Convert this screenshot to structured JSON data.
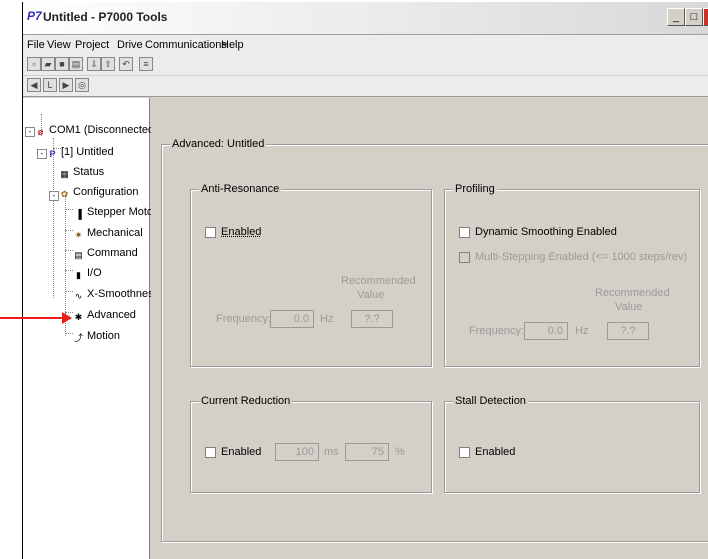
{
  "window": {
    "title": "Untitled - P7000 Tools",
    "app_icon": "P7"
  },
  "menu": [
    "File",
    "View",
    "Project",
    "Drive",
    "Communications",
    "Help"
  ],
  "tree": {
    "com1": "COM1 (Disconnected)",
    "project": "[1] Untitled",
    "status": "Status",
    "configuration": "Configuration",
    "stepper_motor": "Stepper Motor",
    "mechanical": "Mechanical",
    "command": "Command",
    "io": "I/O",
    "x_smoothness": "X-Smoothness",
    "advanced": "Advanced",
    "motion": "Motion"
  },
  "panel": {
    "title": "Advanced: Untitled",
    "anti_resonance": {
      "title": "Anti-Resonance",
      "enabled_label": "Enabled",
      "recommended_label": "Recommended",
      "value_label": "Value",
      "frequency_label": "Frequency:",
      "frequency_value": "0.0",
      "unit": "Hz",
      "recommended_value": "?.?"
    },
    "profiling": {
      "title": "Profiling",
      "dynamic_smoothing_label": "Dynamic Smoothing Enabled",
      "multi_stepping_label": "Multi-Stepping Enabled (<= 1000 steps/rev)",
      "recommended_label": "Recommended",
      "value_label": "Value",
      "frequency_label": "Frequency:",
      "frequency_value": "0.0",
      "unit": "Hz",
      "recommended_value": "?.?"
    },
    "current_reduction": {
      "title": "Current Reduction",
      "enabled_label": "Enabled",
      "ms_value": "100",
      "ms_unit": "ms",
      "pct_value": "75",
      "pct_unit": "%"
    },
    "stall_detection": {
      "title": "Stall Detection",
      "enabled_label": "Enabled"
    }
  },
  "colors": {
    "arrow": "#ee1c1c",
    "panel_bg": "#d4d0c8"
  }
}
